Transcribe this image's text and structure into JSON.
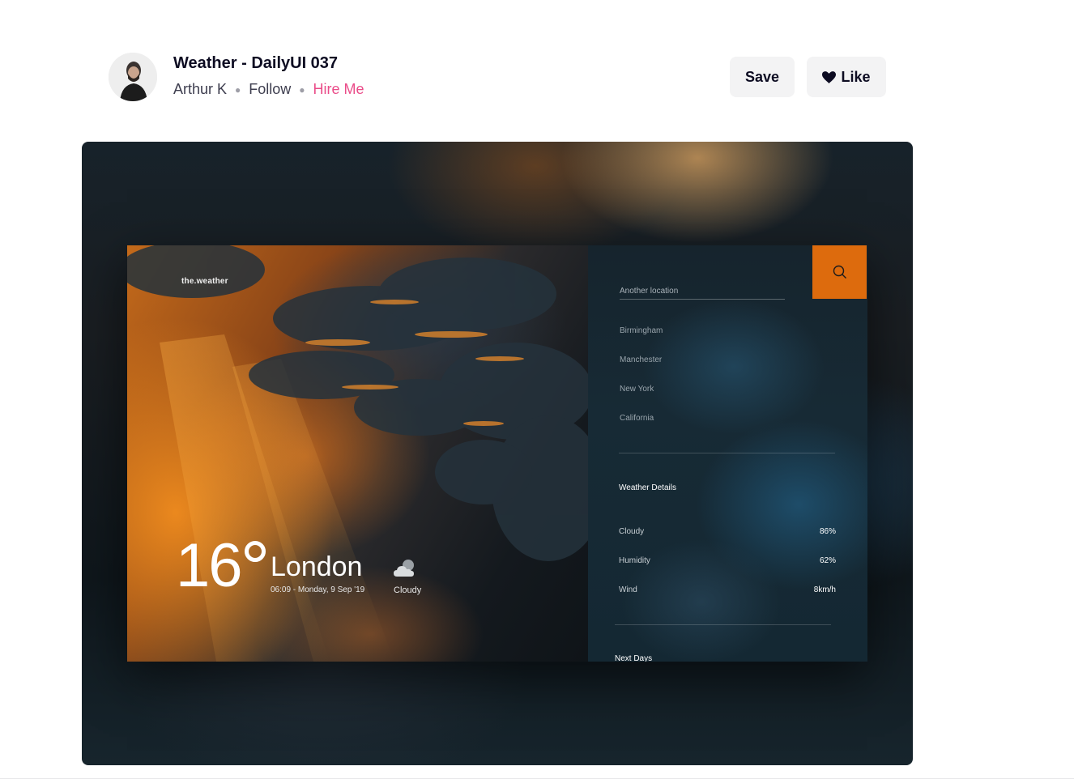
{
  "header": {
    "title": "Weather - DailyUI 037",
    "author": "Arthur K",
    "follow_label": "Follow",
    "hire_label": "Hire Me",
    "save_label": "Save",
    "like_label": "Like",
    "avatar_icon": "user-avatar",
    "like_icon": "heart-icon"
  },
  "shot": {
    "brand": "the.weather",
    "temperature": "16",
    "city": "London",
    "datetime": "06:09 - Monday, 9 Sep '19",
    "condition": "Cloudy",
    "condition_icon": "cloud-icon",
    "search": {
      "placeholder": "Another location",
      "icon": "search-icon",
      "button_color": "#dd6b0d"
    },
    "locations": [
      "Birmingham",
      "Manchester",
      "New York",
      "California"
    ],
    "details_title": "Weather Details",
    "details": [
      {
        "label": "Cloudy",
        "value": "86%"
      },
      {
        "label": "Humidity",
        "value": "62%"
      },
      {
        "label": "Wind",
        "value": "8km/h"
      }
    ],
    "next_days_title": "Next Days"
  },
  "colors": {
    "hire_me": "#ea4c89",
    "accent": "#dd6b0d"
  }
}
